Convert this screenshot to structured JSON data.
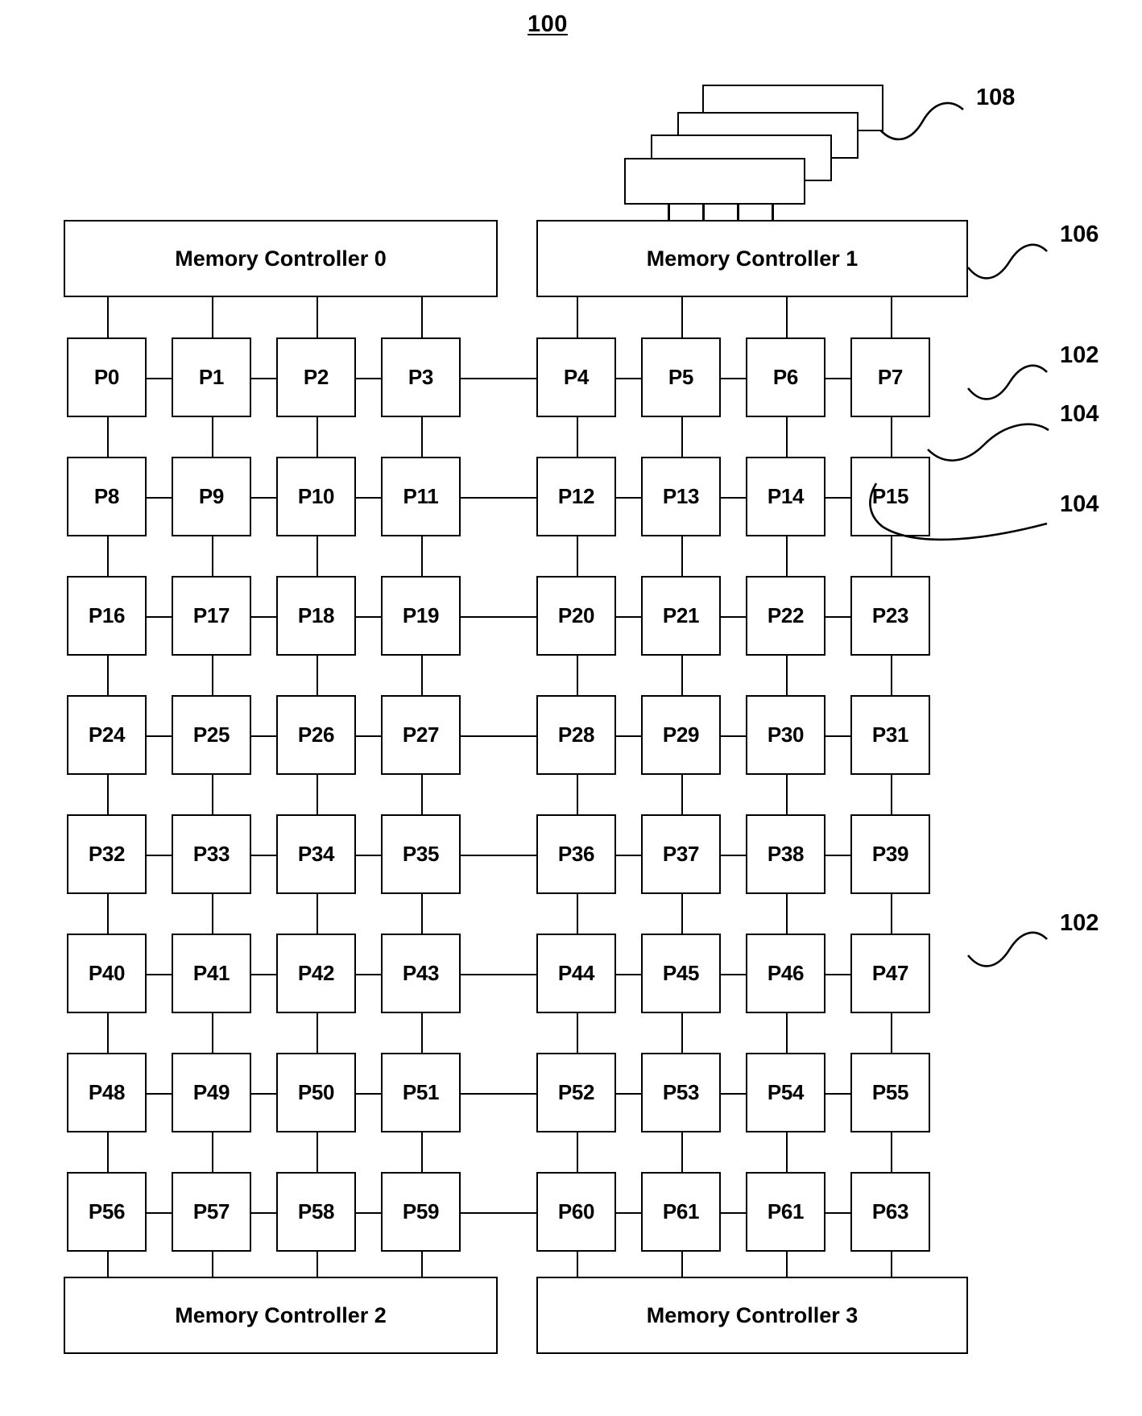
{
  "figure": {
    "number": "100",
    "title_label": "100"
  },
  "memory_controllers": {
    "top": [
      {
        "id": "mc0",
        "label": "Memory Controller 0"
      },
      {
        "id": "mc1",
        "label": "Memory Controller 1"
      }
    ],
    "bottom": [
      {
        "id": "mc2",
        "label": "Memory Controller 2"
      },
      {
        "id": "mc3",
        "label": "Memory Controller 3"
      }
    ]
  },
  "memory_modules": {
    "label": "memory-module-stack",
    "count": 4
  },
  "processor_grid": {
    "columns": 8,
    "rows": 8,
    "nodes": [
      [
        "P0",
        "P1",
        "P2",
        "P3",
        "P4",
        "P5",
        "P6",
        "P7"
      ],
      [
        "P8",
        "P9",
        "P10",
        "P11",
        "P12",
        "P13",
        "P14",
        "P15"
      ],
      [
        "P16",
        "P17",
        "P18",
        "P19",
        "P20",
        "P21",
        "P22",
        "P23"
      ],
      [
        "P24",
        "P25",
        "P26",
        "P27",
        "P28",
        "P29",
        "P30",
        "P31"
      ],
      [
        "P32",
        "P33",
        "P34",
        "P35",
        "P36",
        "P37",
        "P38",
        "P39"
      ],
      [
        "P40",
        "P41",
        "P42",
        "P43",
        "P44",
        "P45",
        "P46",
        "P47"
      ],
      [
        "P48",
        "P49",
        "P50",
        "P51",
        "P52",
        "P53",
        "P54",
        "P55"
      ],
      [
        "P56",
        "P57",
        "P58",
        "P59",
        "P60",
        "P61",
        "P61",
        "P63"
      ]
    ]
  },
  "reference_numerals": [
    {
      "id": "ref-108",
      "value": "108",
      "refers_to": "memory-module-stack"
    },
    {
      "id": "ref-106",
      "value": "106",
      "refers_to": "memory-controller-1"
    },
    {
      "id": "ref-102-top",
      "value": "102",
      "refers_to": "processor-node-p7"
    },
    {
      "id": "ref-104-top",
      "value": "104",
      "refers_to": "vertical-link-p7-p15"
    },
    {
      "id": "ref-104-bottom",
      "value": "104",
      "refers_to": "horizontal-link-p14-p15"
    },
    {
      "id": "ref-102-mid",
      "value": "102",
      "refers_to": "processor-node-p47"
    }
  ],
  "colors": {
    "stroke": "#000000",
    "background": "#ffffff"
  }
}
